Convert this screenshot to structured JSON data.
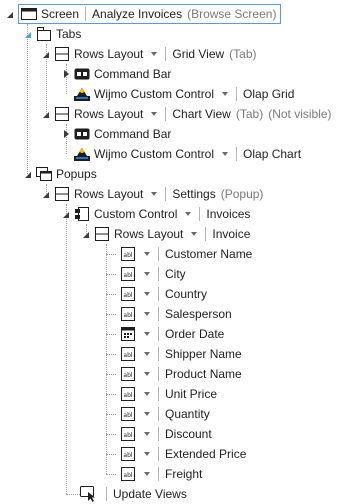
{
  "root": {
    "type": "Screen",
    "name": "Analyze Invoices",
    "note": "(Browse Screen)"
  },
  "tabs": {
    "label": "Tabs"
  },
  "grid_tab": {
    "layout": "Rows Layout",
    "name": "Grid View",
    "note": "(Tab)"
  },
  "grid_cmd": {
    "label": "Command Bar"
  },
  "grid_wijmo": {
    "type": "Wijmo Custom Control",
    "name": "Olap Grid"
  },
  "chart_tab": {
    "layout": "Rows Layout",
    "name": "Chart View",
    "note": "(Tab)",
    "note2": "(Not visible)"
  },
  "chart_cmd": {
    "label": "Command Bar"
  },
  "chart_wijmo": {
    "type": "Wijmo Custom Control",
    "name": "Olap Chart"
  },
  "popups": {
    "label": "Popups"
  },
  "settings": {
    "layout": "Rows Layout",
    "name": "Settings",
    "note": "(Popup)"
  },
  "custom": {
    "type": "Custom Control",
    "name": "Invoices"
  },
  "invoice": {
    "layout": "Rows Layout",
    "name": "Invoice"
  },
  "fields": [
    {
      "label": "Customer Name",
      "icon": "textbox-icon"
    },
    {
      "label": "City",
      "icon": "textbox-icon"
    },
    {
      "label": "Country",
      "icon": "textbox-icon"
    },
    {
      "label": "Salesperson",
      "icon": "textbox-icon"
    },
    {
      "label": "Order Date",
      "icon": "date-picker-icon"
    },
    {
      "label": "Shipper Name",
      "icon": "textbox-icon"
    },
    {
      "label": "Product Name",
      "icon": "textbox-icon"
    },
    {
      "label": "Unit Price",
      "icon": "textbox-icon"
    },
    {
      "label": "Quantity",
      "icon": "textbox-icon"
    },
    {
      "label": "Discount",
      "icon": "textbox-icon"
    },
    {
      "label": "Extended Price",
      "icon": "textbox-icon"
    },
    {
      "label": "Freight",
      "icon": "textbox-icon"
    }
  ],
  "update": {
    "label": "Update Views"
  },
  "colors": {
    "selection_border": "#5b9bd5",
    "muted_text": "#7a7a7a",
    "icon_blue": "#2e75b6",
    "expander_blue": "#4aa8d8"
  }
}
